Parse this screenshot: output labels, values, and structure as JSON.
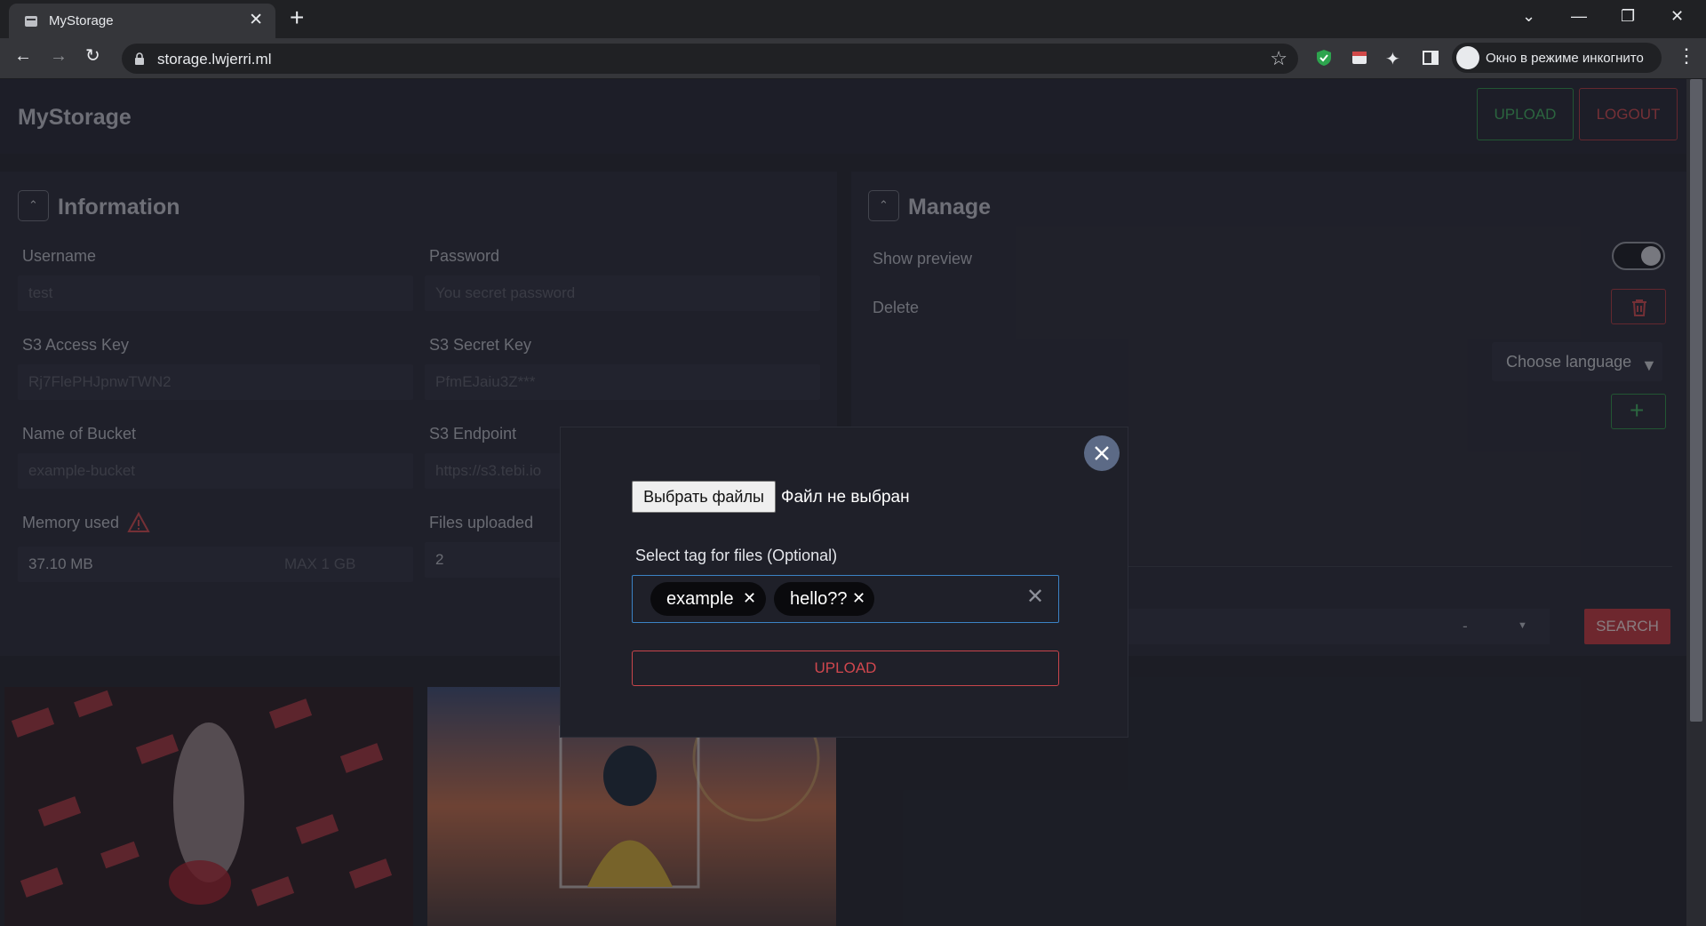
{
  "browser": {
    "tab_title": "MyStorage",
    "url": "storage.lwjerri.ml",
    "incognito_label": "Окно в режиме инкогнито"
  },
  "app": {
    "brand": "MyStorage",
    "upload_button": "UPLOAD",
    "logout_button": "LOGOUT"
  },
  "information": {
    "title": "Information",
    "username_label": "Username",
    "username_value": "test",
    "password_label": "Password",
    "password_placeholder": "You secret password",
    "access_key_label": "S3 Access Key",
    "access_key_value": "Rj7FlePHJpnwTWN2",
    "secret_key_label": "S3 Secret Key",
    "secret_key_value": "PfmEJaiu3Z***",
    "bucket_label": "Name of Bucket",
    "bucket_value": "example-bucket",
    "endpoint_label": "S3 Endpoint",
    "endpoint_value": "https://s3.tebi.io",
    "memory_label": "Memory used",
    "memory_value": "37.10 MB",
    "memory_max": "MAX 1 GB",
    "files_label": "Files uploaded",
    "files_value": "2"
  },
  "manage": {
    "title": "Manage",
    "show_preview_label": "Show preview",
    "show_preview_on": true,
    "delete_label": "Delete",
    "language_dropdown": "Choose language",
    "sort_value": "-",
    "search_button": "SEARCH"
  },
  "modal": {
    "file_button": "Выбрать файлы",
    "file_status": "Файл не выбран",
    "tag_label": "Select tag for files (Optional)",
    "tags": [
      "example",
      "hello??"
    ],
    "upload_button": "UPLOAD"
  },
  "colors": {
    "upload_green": "#3fa85e",
    "danger_red": "#c4474e",
    "focus_blue": "#3b82c4"
  }
}
